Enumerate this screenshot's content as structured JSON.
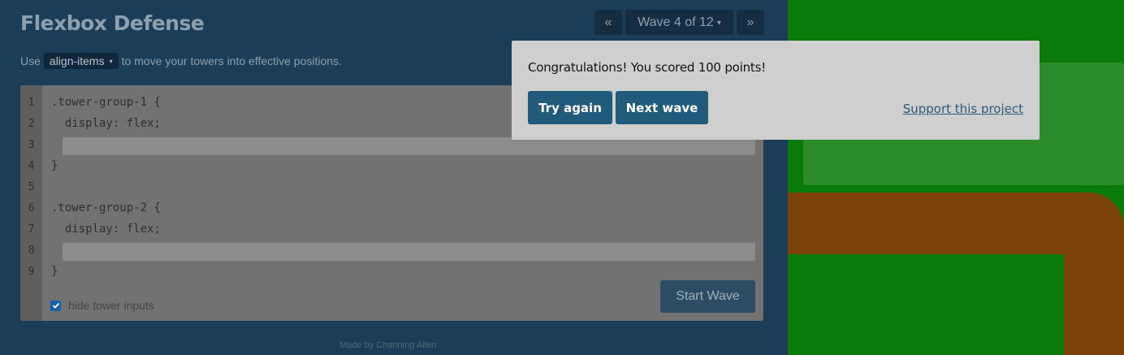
{
  "header": {
    "title": "Flexbox Defense",
    "prev_label": "«",
    "wave_label": "Wave 4 of 12",
    "wave_caret": "▾",
    "next_label": "»"
  },
  "instructions": {
    "prefix": "Use",
    "property": "align-items",
    "property_caret": "▾",
    "suffix": "to move your towers into effective positions."
  },
  "editor": {
    "line_numbers": [
      "1",
      "2",
      "3",
      "4",
      "5",
      "6",
      "7",
      "8",
      "9"
    ],
    "lines": [
      ".tower-group-1 {",
      "  display: flex;",
      "",
      "}",
      "",
      ".tower-group-2 {",
      "  display: flex;",
      "",
      "}"
    ],
    "start_label": "Start Wave",
    "hide_inputs_label": "hide tower inputs",
    "hide_inputs_checked": true
  },
  "footer": {
    "credit": "Made by Channing Allen"
  },
  "modal": {
    "message": "Congratulations! You scored 100 points!",
    "try_again_label": "Try again",
    "next_wave_label": "Next wave",
    "support_label": "Support this project"
  },
  "colors": {
    "background": "#1b3d57",
    "grass": "#0a7a0a",
    "tower_zone": "#2c8c2c",
    "road": "#7a4208",
    "modal_button": "#225a7c"
  }
}
